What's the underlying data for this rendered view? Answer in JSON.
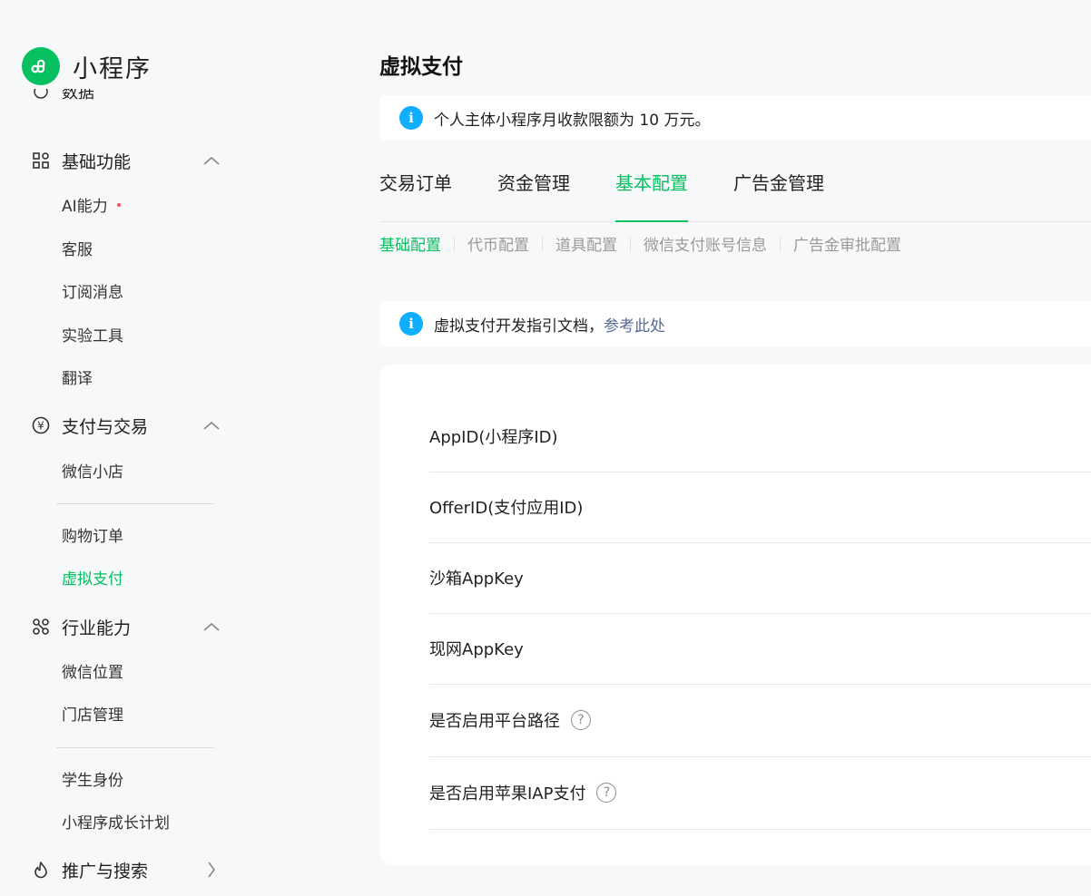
{
  "app": {
    "logo_text": "小程序",
    "brand_color": "#07c160"
  },
  "sidebar": {
    "cut_item": "数据",
    "groups": [
      {
        "label": "基础功能",
        "icon": "grid-apps-icon",
        "expanded": true,
        "items": [
          "AI能力",
          "客服",
          "订阅消息",
          "实验工具",
          "翻译"
        ]
      },
      {
        "label": "支付与交易",
        "icon": "yuan-circle-icon",
        "expanded": true,
        "items": [
          "微信小店",
          "购物订单",
          "虚拟支付"
        ]
      },
      {
        "label": "行业能力",
        "icon": "nodes-icon",
        "expanded": true,
        "items": [
          "微信位置",
          "门店管理",
          "学生身份",
          "小程序成长计划"
        ]
      },
      {
        "label": "推广与搜索",
        "icon": "flame-icon",
        "expanded": false,
        "items": []
      }
    ],
    "active_item": "虚拟支付"
  },
  "main": {
    "title": "虚拟支付",
    "notice_top": "个人主体小程序月收款限额为 10 万元。",
    "tabs": [
      "交易订单",
      "资金管理",
      "基本配置",
      "广告金管理"
    ],
    "active_tab": "基本配置",
    "subtabs": [
      "基础配置",
      "代币配置",
      "道具配置",
      "微信支付账号信息",
      "广告金审批配置"
    ],
    "active_subtab": "基础配置",
    "notice_doc_text": "虚拟支付开发指引文档，",
    "notice_doc_link": "参考此处",
    "config_rows": [
      {
        "label": "AppID(小程序ID)",
        "help": false
      },
      {
        "label": "OfferID(支付应用ID)",
        "help": false
      },
      {
        "label": "沙箱AppKey",
        "help": false
      },
      {
        "label": "现网AppKey",
        "help": false
      },
      {
        "label": "是否启用平台路径",
        "help": true
      },
      {
        "label": "是否启用苹果IAP支付",
        "help": true
      }
    ]
  }
}
